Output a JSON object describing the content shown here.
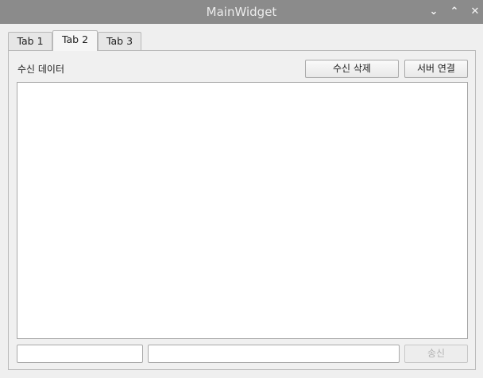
{
  "window": {
    "title": "MainWidget"
  },
  "titlebar_buttons": {
    "minimize_glyph": "⌄",
    "maximize_glyph": "⌃",
    "close_glyph": "✕"
  },
  "tabs": [
    {
      "label": "Tab 1",
      "active": false
    },
    {
      "label": "Tab 2",
      "active": true
    },
    {
      "label": "Tab 3",
      "active": false
    }
  ],
  "main": {
    "received_label": "수신 데이터",
    "clear_button": "수신 삭제",
    "connect_button": "서버 연결",
    "received_text": "",
    "input1": {
      "value": "",
      "placeholder": ""
    },
    "input2": {
      "value": "",
      "placeholder": ""
    },
    "send_button": "송신",
    "send_enabled": false
  }
}
